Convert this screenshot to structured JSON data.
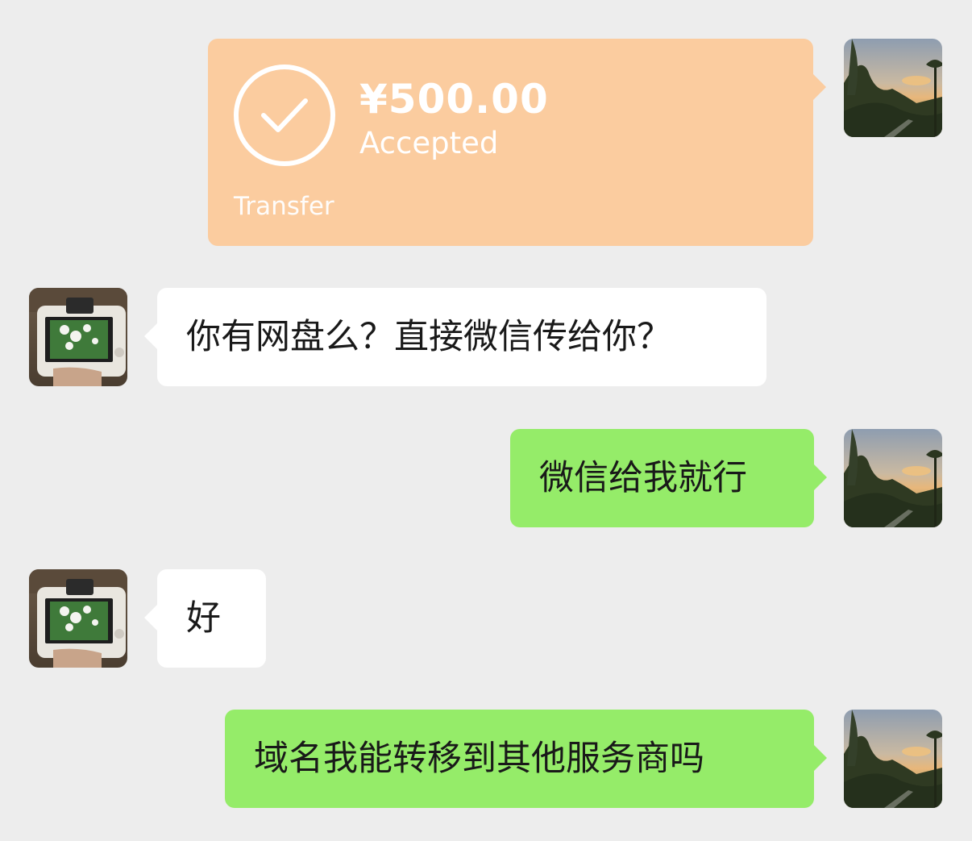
{
  "transfer": {
    "amount": "¥500.00",
    "status": "Accepted",
    "label": "Transfer",
    "icon": "check-circle-icon",
    "color": "#fbcc9f"
  },
  "messages": [
    {
      "sender": "other",
      "text": "你有网盘么？直接微信传给你？"
    },
    {
      "sender": "self",
      "text": "微信给我就行"
    },
    {
      "sender": "other",
      "text": "好"
    },
    {
      "sender": "self",
      "text": "域名我能转移到其他服务商吗"
    }
  ],
  "colors": {
    "background": "#ededed",
    "self_bubble": "#95ec69",
    "other_bubble": "#ffffff"
  }
}
